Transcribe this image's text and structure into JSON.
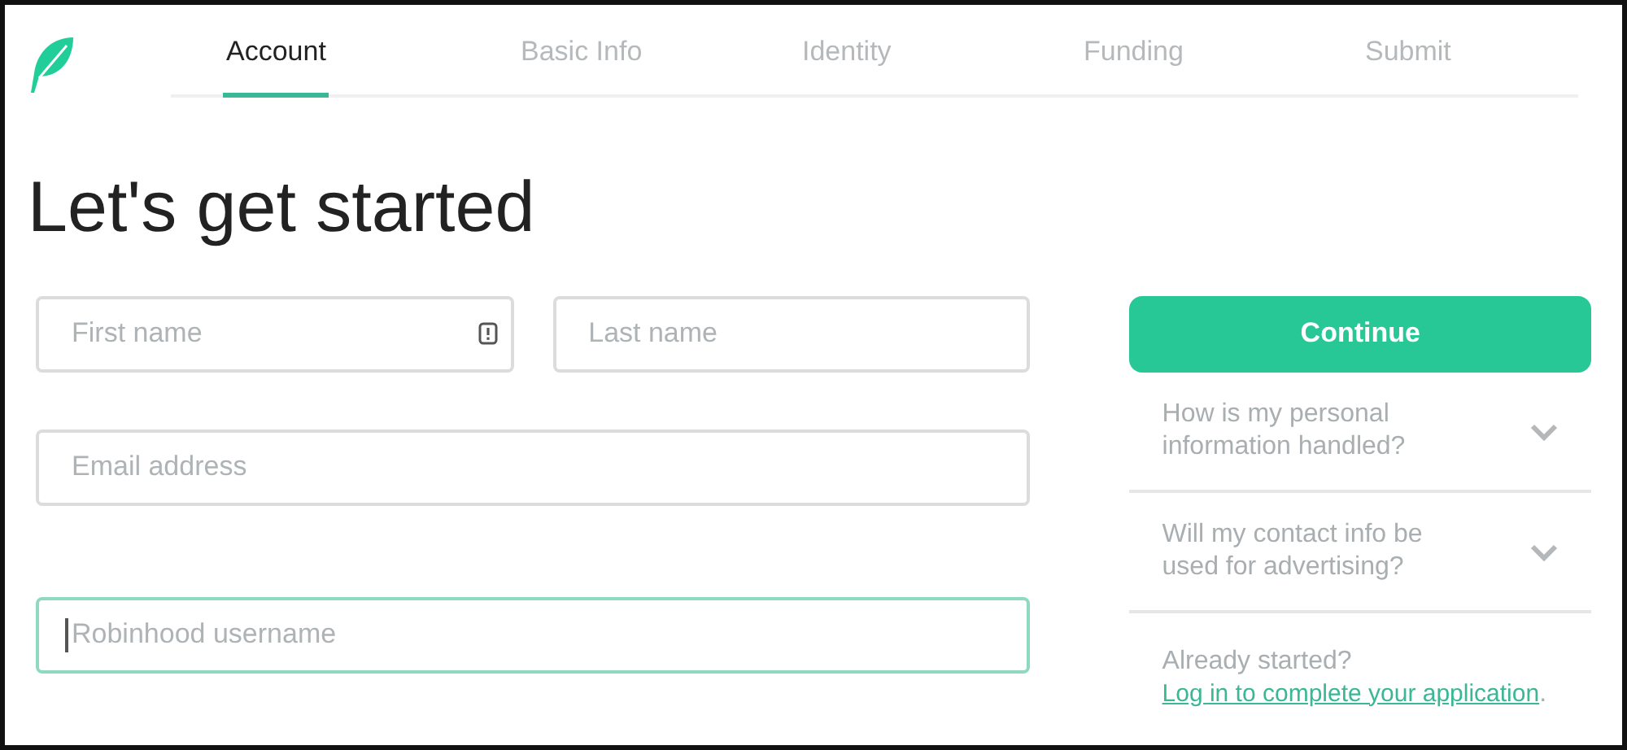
{
  "tabs": [
    {
      "label": "Account",
      "selected": true
    },
    {
      "label": "Basic Info",
      "selected": false
    },
    {
      "label": "Identity",
      "selected": false
    },
    {
      "label": "Funding",
      "selected": false
    },
    {
      "label": "Submit",
      "selected": false
    }
  ],
  "heading": "Let's get started",
  "fields": [
    {
      "placeholder": "First name",
      "focused": false,
      "alert_icon": true
    },
    {
      "placeholder": "Last name",
      "focused": false,
      "alert_icon": false
    },
    {
      "placeholder": "Email address",
      "focused": false,
      "alert_icon": false
    },
    {
      "placeholder": "Robinhood username",
      "focused": true,
      "alert_icon": false
    }
  ],
  "continue_button": "Continue",
  "faq": [
    {
      "question": "How is my personal information handled?",
      "expanded": false
    },
    {
      "question": "Will my contact info be used for advertising?",
      "expanded": false
    }
  ],
  "login_note": {
    "prefix": "Already started?",
    "link": "Log in to complete your application",
    "suffix": "."
  }
}
